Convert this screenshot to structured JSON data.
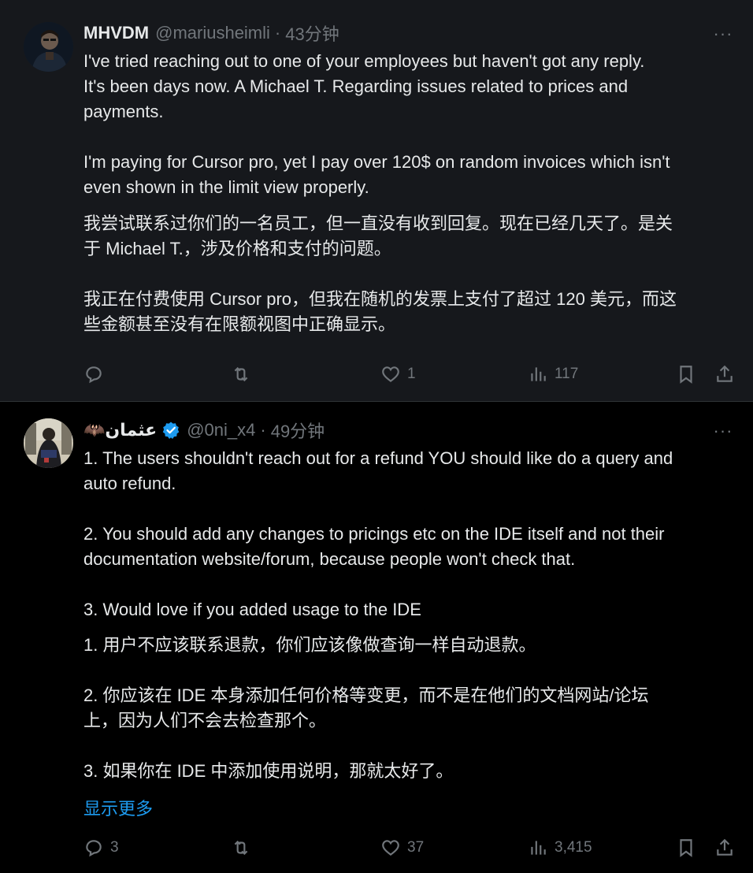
{
  "tweets": [
    {
      "display_name": "MHVDM",
      "handle": "@mariusheimli",
      "time": "43分钟",
      "body_en": "I've tried reaching out to one of your employees but haven't got any reply.\nIt's been days now. A Michael T. Regarding issues related to prices and\npayments.\n\nI'm paying for Cursor pro, yet I pay over 120$ on random invoices which isn't\neven shown in the limit view properly.",
      "body_zh": "我尝试联系过你们的一名员工，但一直没有收到回复。现在已经几天了。是关\n于 Michael T.，涉及价格和支付的问题。\n\n我正在付费使用 Cursor pro，但我在随机的发票上支付了超过 120 美元，而这\n些金额甚至没有在限额视图中正确显示。",
      "replies": "",
      "reposts": "",
      "likes": "1",
      "views": "117"
    },
    {
      "display_name": "🦇عثمان",
      "handle": "@0ni_x4",
      "time": "49分钟",
      "body_en": "1. The users shouldn't reach out for a refund YOU should like do a query and\nauto refund.\n\n2. You should add any changes to pricings etc on the IDE itself and not their\ndocumentation website/forum, because people won't check that.\n\n3. Would love if you added usage to the IDE",
      "body_zh": "1. 用户不应该联系退款，你们应该像做查询一样自动退款。\n\n2. 你应该在 IDE 本身添加任何价格等变更，而不是在他们的文档网站/论坛\n上，因为人们不会去检查那个。\n\n3. 如果你在 IDE 中添加使用说明，那就太好了。",
      "show_more": "显示更多",
      "replies": "3",
      "reposts": "",
      "likes": "37",
      "views": "3,415"
    }
  ],
  "separator": "·",
  "more_glyph": "···",
  "icons": {
    "reply": "reply-icon",
    "repost": "repost-icon",
    "like": "heart-icon",
    "views": "views-icon",
    "bookmark": "bookmark-icon",
    "share": "share-icon",
    "verified": "verified-badge-icon"
  },
  "colors": {
    "text": "#e7e9ea",
    "muted": "#71767b",
    "link": "#1d9bf0",
    "highlight_bg": "#16181c",
    "divider": "#2f3336"
  }
}
